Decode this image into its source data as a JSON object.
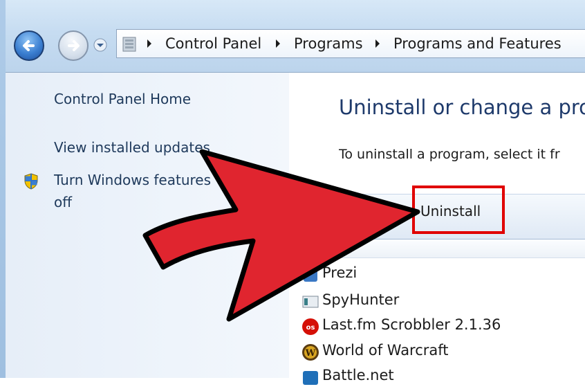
{
  "address_bar": {
    "breadcrumbs": [
      "Control Panel",
      "Programs",
      "Programs and Features"
    ]
  },
  "left_pane": {
    "links": {
      "home": "Control Panel Home",
      "updates": "View installed updates",
      "features_line1": "Turn Windows features",
      "features_line2": "off"
    }
  },
  "main": {
    "title": "Uninstall or change a prog",
    "subtitle": "To uninstall a program, select it fr",
    "toolbar": {
      "uninstall_label": "Uninstall"
    },
    "programs": [
      {
        "name": "Prezi",
        "icon": "prezi-icon"
      },
      {
        "name": "SpyHunter",
        "icon": "spyhunter-icon"
      },
      {
        "name": "Last.fm Scrobbler 2.1.36",
        "icon": "lastfm-icon"
      },
      {
        "name": "World of Warcraft",
        "icon": "warcraft-icon"
      },
      {
        "name": "Battle.net",
        "icon": "battlenet-icon"
      }
    ]
  },
  "annotation": {
    "arrow_color": "#e0252f",
    "highlight_color": "#e00000"
  }
}
